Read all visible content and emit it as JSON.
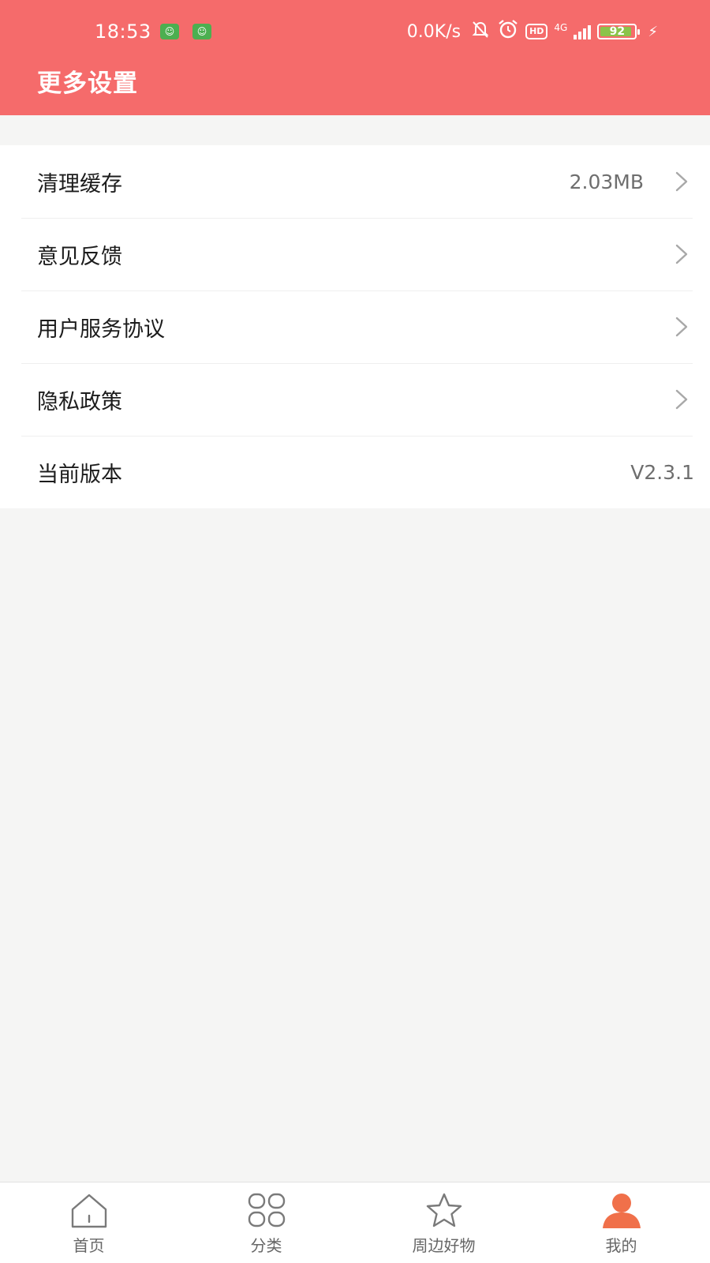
{
  "status_bar": {
    "time": "18:53",
    "net_speed": "0.0K/s",
    "hd": "HD",
    "net_type": "4G",
    "battery_level": "92",
    "battery_fraction": 0.92
  },
  "header": {
    "title": "更多设置"
  },
  "settings": [
    {
      "label": "清理缓存",
      "value": "2.03MB",
      "chevron": true
    },
    {
      "label": "意见反馈",
      "value": "",
      "chevron": true
    },
    {
      "label": "用户服务协议",
      "value": "",
      "chevron": true
    },
    {
      "label": "隐私政策",
      "value": "",
      "chevron": true
    },
    {
      "label": "当前版本",
      "value": "V2.3.1",
      "chevron": false
    }
  ],
  "tabbar": {
    "items": [
      {
        "label": "首页",
        "icon": "home-icon"
      },
      {
        "label": "分类",
        "icon": "grid-icon"
      },
      {
        "label": "周边好物",
        "icon": "star-icon"
      },
      {
        "label": "我的",
        "icon": "user-icon"
      }
    ],
    "active_index": 3
  },
  "colors": {
    "header_bg": "#f56b6b",
    "active_tab": "#f0704a",
    "inactive_icon": "#7a7a7a",
    "page_bg": "#f5f5f4"
  }
}
